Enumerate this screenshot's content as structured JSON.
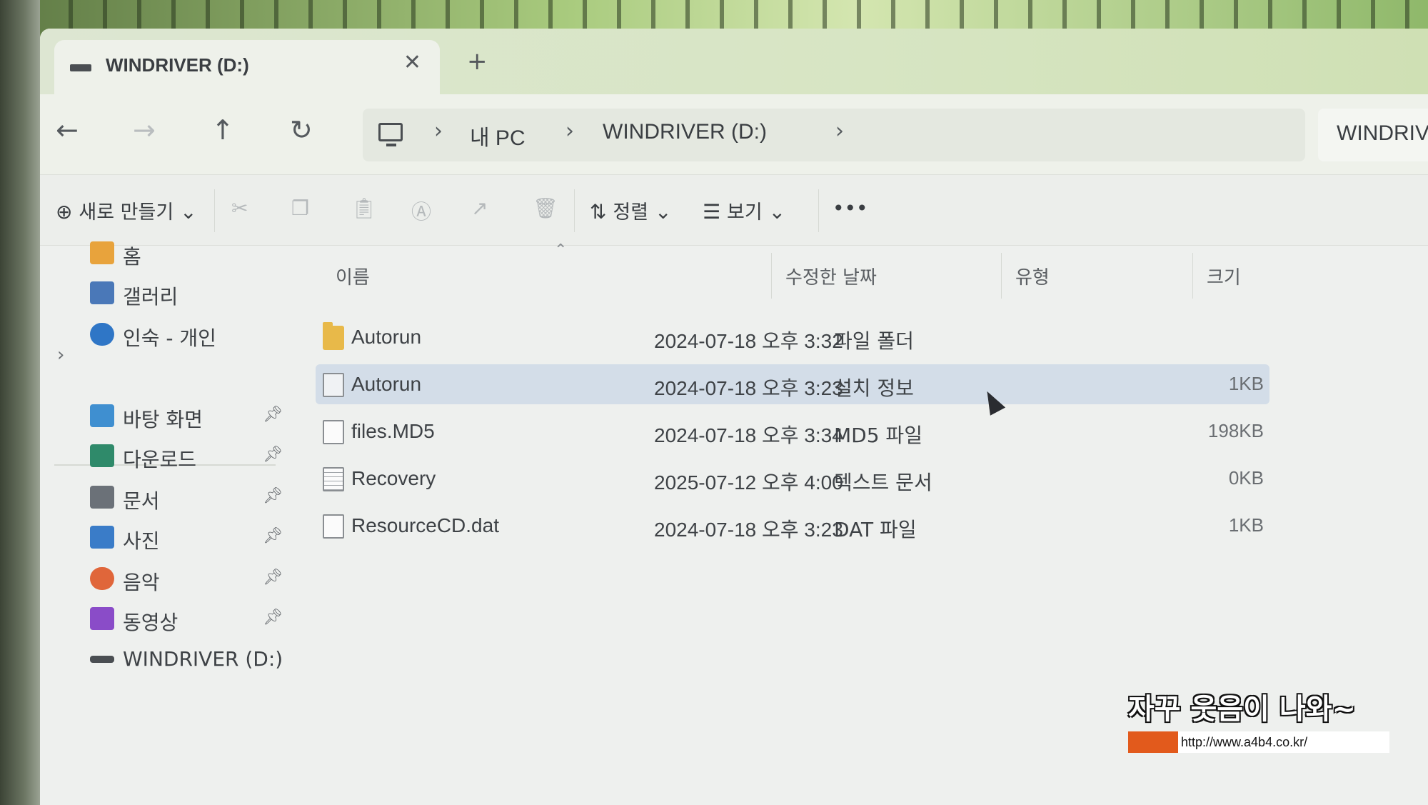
{
  "tab": {
    "title": "WINDRIVER (D:)",
    "close_glyph": "✕",
    "new_tab_glyph": "+"
  },
  "nav": {
    "back_glyph": "←",
    "forward_glyph": "→",
    "up_glyph": "↑",
    "refresh_glyph": "↻",
    "breadcrumb": [
      "내 PC",
      "WINDRIVER (D:)"
    ],
    "separator_glyph": "›",
    "search_text": "WINDRIVER (D:)"
  },
  "toolbar": {
    "new_label": "새로 만들기",
    "sort_label": "정렬",
    "view_label": "보기",
    "more_glyph": "•••"
  },
  "sidebar": {
    "items": [
      {
        "label": "홈",
        "icon": "home-icon",
        "color": "#e8a33c"
      },
      {
        "label": "갤러리",
        "icon": "gallery-icon",
        "color": "#4a78b8"
      },
      {
        "label": "인숙 - 개인",
        "icon": "onedrive-icon",
        "color": "#2f76c6"
      }
    ],
    "pinned": [
      {
        "label": "바탕 화면",
        "icon": "desktop-icon",
        "color": "#3f8fd0"
      },
      {
        "label": "다운로드",
        "icon": "download-icon",
        "color": "#2f8a6a"
      },
      {
        "label": "문서",
        "icon": "documents-icon",
        "color": "#6b7178"
      },
      {
        "label": "사진",
        "icon": "pictures-icon",
        "color": "#3a7cc8"
      },
      {
        "label": "음악",
        "icon": "music-icon",
        "color": "#e0663a"
      },
      {
        "label": "동영상",
        "icon": "videos-icon",
        "color": "#8a4cc8"
      }
    ],
    "drive_label": "WINDRIVER (D:)"
  },
  "columns": {
    "name": "이름",
    "date": "수정한 날짜",
    "type": "유형",
    "size": "크기"
  },
  "files": [
    {
      "name": "Autorun",
      "date": "2024-07-18 오후 3:32",
      "type": "파일 폴더",
      "size": "",
      "icon": "folder-icon",
      "selected": false
    },
    {
      "name": "Autorun",
      "date": "2024-07-18 오후 3:23",
      "type": "설치 정보",
      "size": "1KB",
      "icon": "setup-info-icon",
      "selected": true
    },
    {
      "name": "files.MD5",
      "date": "2024-07-18 오후 3:34",
      "type": "MD5 파일",
      "size": "198KB",
      "icon": "file-icon",
      "selected": false
    },
    {
      "name": "Recovery",
      "date": "2025-07-12 오후 4:00",
      "type": "텍스트 문서",
      "size": "0KB",
      "icon": "text-file-icon",
      "selected": false
    },
    {
      "name": "ResourceCD.dat",
      "date": "2024-07-18 오후 3:23",
      "type": "DAT 파일",
      "size": "1KB",
      "icon": "file-icon",
      "selected": false
    }
  ],
  "watermark": {
    "title": "자꾸 웃음이 나와~",
    "url": "http://www.a4b4.co.kr/"
  }
}
